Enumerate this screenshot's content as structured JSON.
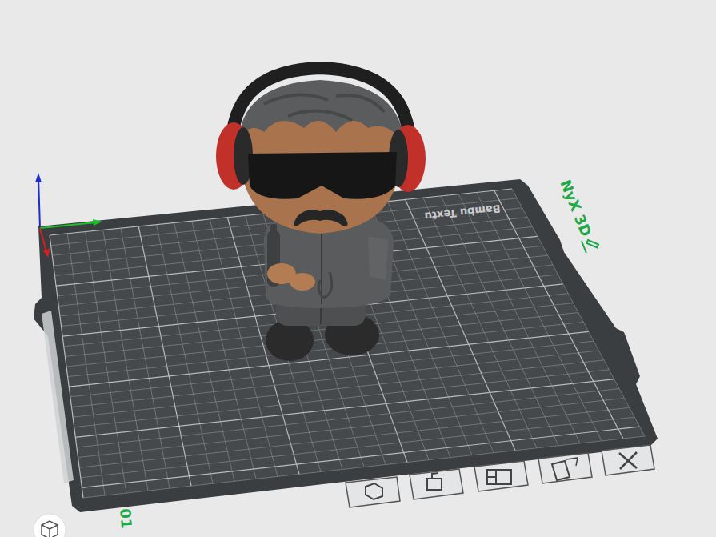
{
  "viewport": {
    "plate": {
      "texture_label": "Bambu Textu",
      "name": "NyX 3D",
      "index": "01"
    }
  }
}
